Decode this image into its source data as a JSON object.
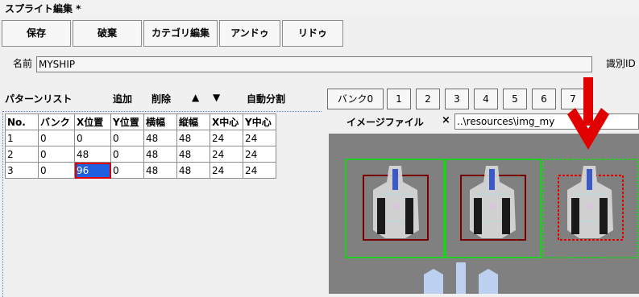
{
  "window": {
    "title": "スプライト編集 *"
  },
  "toolbar": {
    "save": "保存",
    "discard": "破棄",
    "category_edit": "カテゴリ編集",
    "undo": "アンドゥ",
    "redo": "リドゥ"
  },
  "name_row": {
    "label": "名前",
    "value": "MYSHIP",
    "id_label": "識別ID"
  },
  "pattern_list": {
    "title": "パターンリスト",
    "add": "追加",
    "delete": "削除",
    "up": "▲",
    "down": "▼",
    "auto_split": "自動分割",
    "columns": [
      "No.",
      "バンク",
      "X位置",
      "Y位置",
      "横幅",
      "縦幅",
      "X中心",
      "Y中心"
    ],
    "rows": [
      [
        "1",
        "0",
        "0",
        "0",
        "48",
        "48",
        "24",
        "24"
      ],
      [
        "2",
        "0",
        "48",
        "0",
        "48",
        "48",
        "24",
        "24"
      ],
      [
        "3",
        "0",
        "96",
        "0",
        "48",
        "48",
        "24",
        "24"
      ]
    ]
  },
  "banks": {
    "tabs": [
      "バンク0",
      "1",
      "2",
      "3",
      "4",
      "5",
      "6",
      "7"
    ]
  },
  "image": {
    "label": "イメージファイル",
    "clear": "×",
    "path": "..\\resources\\img_my"
  },
  "colors": {
    "selection": "#1f5fe0",
    "highlight": "#e00000",
    "frame_green": "#22cc22"
  }
}
